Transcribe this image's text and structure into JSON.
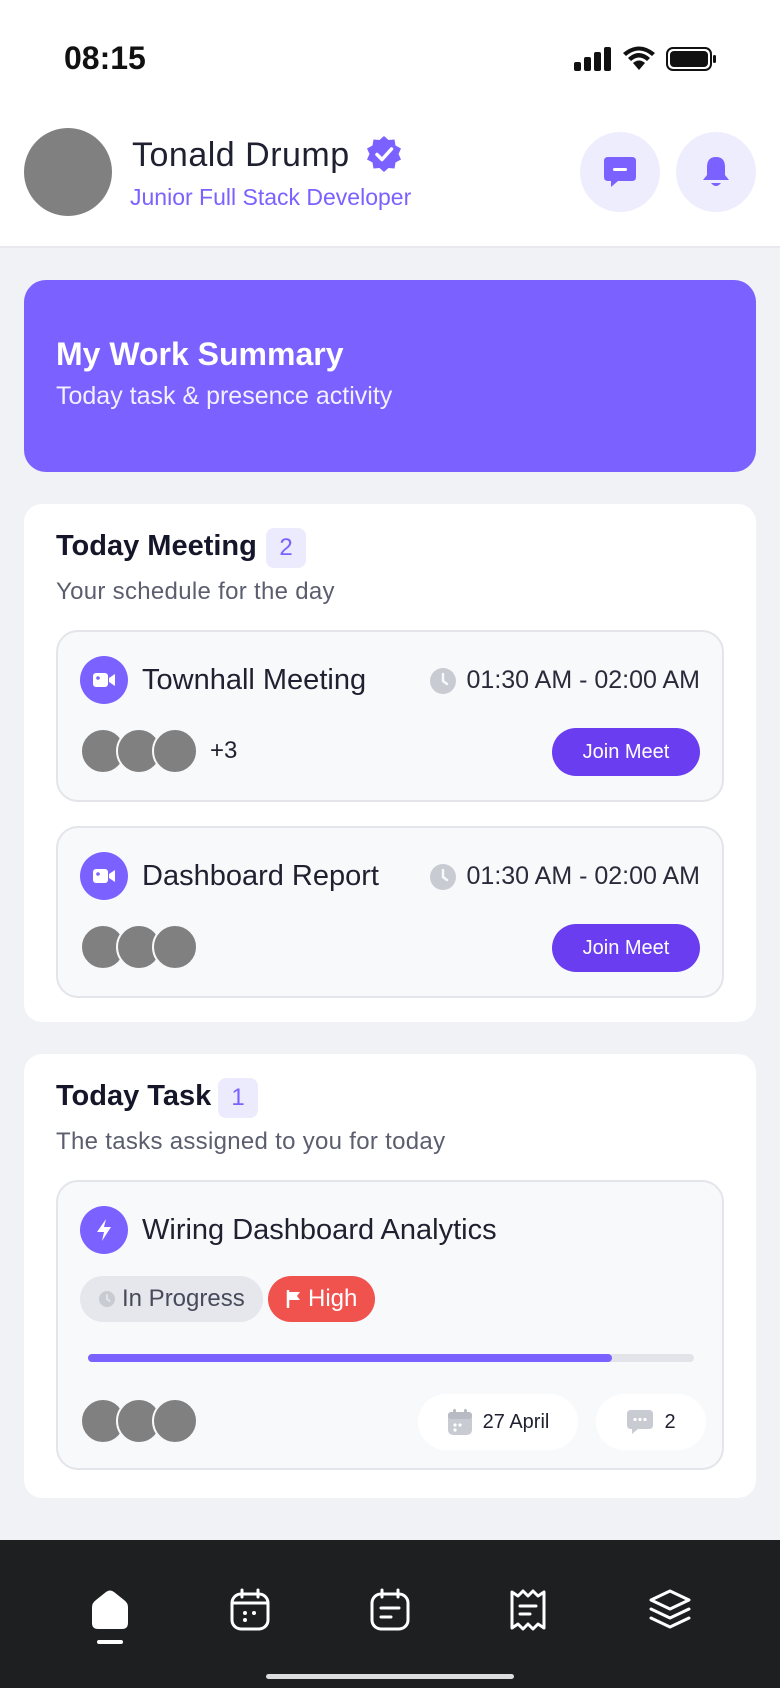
{
  "status_bar": {
    "time": "08:15"
  },
  "profile": {
    "name": "Tonald Drump",
    "role": "Junior Full Stack Developer"
  },
  "summary": {
    "title": "My Work Summary",
    "subtitle": "Today task & presence activity"
  },
  "meetings": {
    "title": "Today Meeting",
    "count": "2",
    "subtitle": "Your schedule for the day",
    "items": [
      {
        "title": "Townhall Meeting",
        "time": "01:30 AM - 02:00 AM",
        "extra_attendees": "+3",
        "join_label": "Join Meet"
      },
      {
        "title": "Dashboard Report",
        "time": "01:30 AM - 02:00 AM",
        "extra_attendees": "",
        "join_label": "Join Meet"
      }
    ]
  },
  "tasks": {
    "title": "Today Task",
    "count": "1",
    "subtitle": "The tasks assigned to you for today",
    "items": [
      {
        "title": "Wiring Dashboard Analytics",
        "status": "In Progress",
        "priority": "High",
        "progress": 0.865,
        "due": "27 April",
        "comments": "2"
      }
    ]
  },
  "nav": {
    "items": [
      "home-icon",
      "calendar-icon",
      "notes-icon",
      "receipt-icon",
      "layers-icon"
    ],
    "active": "home-icon"
  },
  "colors": {
    "accent": "#7B61FF",
    "join_button": "#6A3DF0",
    "priority_high": "#F0524E",
    "nav_bg": "#1E1F21"
  }
}
